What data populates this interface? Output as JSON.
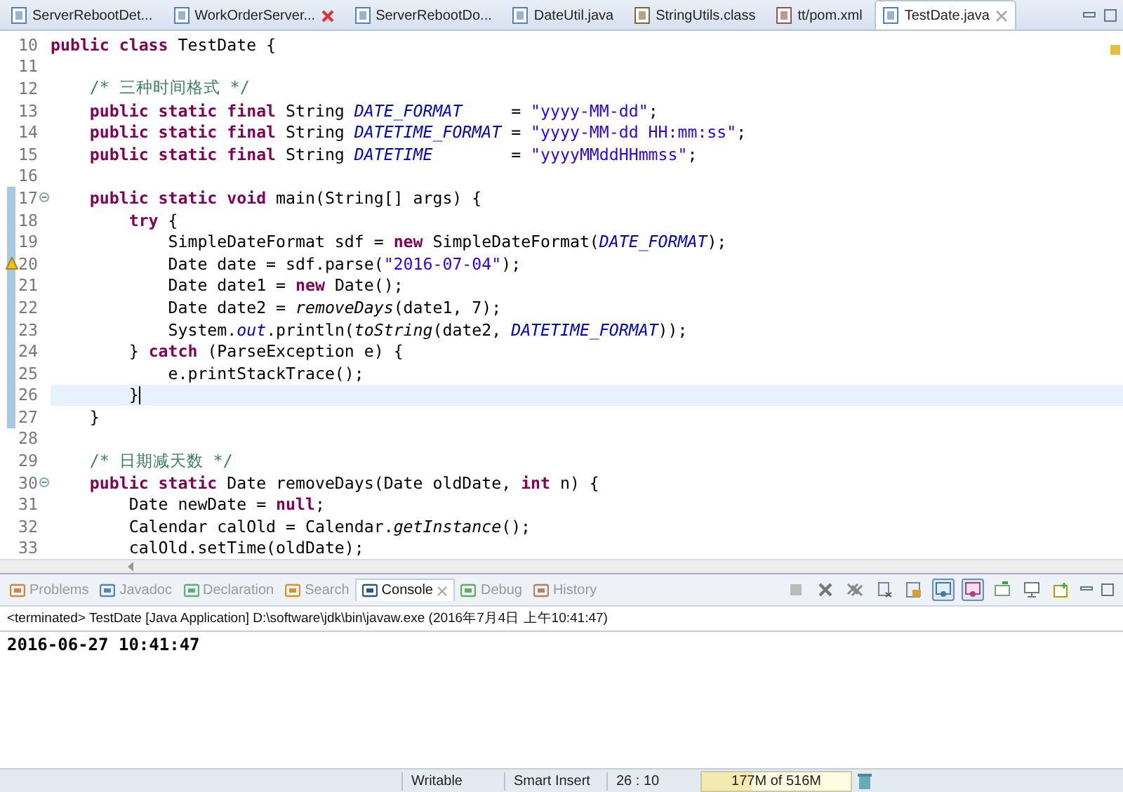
{
  "editor_tabs": [
    {
      "label": "ServerRebootDet...",
      "kind": "java",
      "selected": false,
      "hovered": false
    },
    {
      "label": "WorkOrderServer...",
      "kind": "java",
      "selected": false,
      "hovered": true
    },
    {
      "label": "ServerRebootDo...",
      "kind": "java",
      "selected": false,
      "hovered": false
    },
    {
      "label": "DateUtil.java",
      "kind": "java",
      "selected": false,
      "hovered": false
    },
    {
      "label": "StringUtils.class",
      "kind": "class",
      "selected": false,
      "hovered": false
    },
    {
      "label": "tt/pom.xml",
      "kind": "xml",
      "selected": false,
      "hovered": false
    },
    {
      "label": "TestDate.java",
      "kind": "java",
      "selected": true,
      "hovered": false
    }
  ],
  "editor": {
    "lines": [
      {
        "number": "10",
        "in_range": false,
        "fold": false,
        "warning": false,
        "current": false,
        "segments": [
          {
            "kind": "keyword",
            "text": "public class"
          },
          {
            "kind": "plain",
            "text": " TestDate {"
          }
        ]
      },
      {
        "number": "11",
        "in_range": false,
        "fold": false,
        "warning": false,
        "current": false
      },
      {
        "number": "12",
        "in_range": false,
        "fold": false,
        "warning": false,
        "current": false,
        "segments": [
          {
            "kind": "comment",
            "text": "    /* 三种时间格式 */"
          }
        ]
      },
      {
        "number": "13",
        "in_range": false,
        "fold": false,
        "warning": false,
        "current": false,
        "segments": [
          {
            "kind": "keyword",
            "text": "    public static final"
          },
          {
            "kind": "plain",
            "text": " String "
          },
          {
            "kind": "constant",
            "text": "DATE_FORMAT"
          },
          {
            "kind": "plain",
            "text": "     = "
          },
          {
            "kind": "string",
            "text": "\"yyyy-MM-dd\""
          },
          {
            "kind": "plain",
            "text": ";"
          }
        ]
      },
      {
        "number": "14",
        "in_range": false,
        "fold": false,
        "warning": false,
        "current": false,
        "segments": [
          {
            "kind": "keyword",
            "text": "    public static final"
          },
          {
            "kind": "plain",
            "text": " String "
          },
          {
            "kind": "constant",
            "text": "DATETIME_FORMAT"
          },
          {
            "kind": "plain",
            "text": " = "
          },
          {
            "kind": "string",
            "text": "\"yyyy-MM-dd HH:mm:ss\""
          },
          {
            "kind": "plain",
            "text": ";"
          }
        ]
      },
      {
        "number": "15",
        "in_range": false,
        "fold": false,
        "warning": false,
        "current": false,
        "segments": [
          {
            "kind": "keyword",
            "text": "    public static final"
          },
          {
            "kind": "plain",
            "text": " String "
          },
          {
            "kind": "constant",
            "text": "DATETIME"
          },
          {
            "kind": "plain",
            "text": "        = "
          },
          {
            "kind": "string",
            "text": "\"yyyyMMddHHmmss\""
          },
          {
            "kind": "plain",
            "text": ";"
          }
        ]
      },
      {
        "number": "16",
        "in_range": false,
        "fold": false,
        "warning": false,
        "current": false
      },
      {
        "number": "17",
        "in_range": true,
        "fold": true,
        "warning": false,
        "current": false,
        "segments": [
          {
            "kind": "keyword",
            "text": "    public static void"
          },
          {
            "kind": "plain",
            "text": " main(String[] args) {"
          }
        ]
      },
      {
        "number": "18",
        "in_range": true,
        "fold": false,
        "warning": false,
        "current": false,
        "segments": [
          {
            "kind": "keyword",
            "text": "        try"
          },
          {
            "kind": "plain",
            "text": " {"
          }
        ]
      },
      {
        "number": "19",
        "in_range": true,
        "fold": false,
        "warning": false,
        "current": false,
        "segments": [
          {
            "kind": "plain",
            "text": "            SimpleDateFormat sdf = "
          },
          {
            "kind": "keyword",
            "text": "new"
          },
          {
            "kind": "plain",
            "text": " SimpleDateFormat("
          },
          {
            "kind": "constant",
            "text": "DATE_FORMAT"
          },
          {
            "kind": "plain",
            "text": ");"
          }
        ]
      },
      {
        "number": "20",
        "in_range": true,
        "fold": false,
        "warning": true,
        "current": false,
        "segments": [
          {
            "kind": "plain",
            "text": "            Date date = sdf.parse("
          },
          {
            "kind": "string",
            "text": "\"2016-07-04\""
          },
          {
            "kind": "plain",
            "text": ");"
          }
        ]
      },
      {
        "number": "21",
        "in_range": true,
        "fold": false,
        "warning": false,
        "current": false,
        "segments": [
          {
            "kind": "plain",
            "text": "            Date date1 = "
          },
          {
            "kind": "keyword",
            "text": "new"
          },
          {
            "kind": "plain",
            "text": " Date();"
          }
        ]
      },
      {
        "number": "22",
        "in_range": true,
        "fold": false,
        "warning": false,
        "current": false,
        "segments": [
          {
            "kind": "plain",
            "text": "            Date date2 = "
          },
          {
            "kind": "method",
            "text": "removeDays"
          },
          {
            "kind": "plain",
            "text": "(date1, 7);"
          }
        ]
      },
      {
        "number": "23",
        "in_range": true,
        "fold": false,
        "warning": false,
        "current": false,
        "segments": [
          {
            "kind": "plain",
            "text": "            System."
          },
          {
            "kind": "constant",
            "text": "out"
          },
          {
            "kind": "plain",
            "text": ".println("
          },
          {
            "kind": "method",
            "text": "toString"
          },
          {
            "kind": "plain",
            "text": "(date2, "
          },
          {
            "kind": "constant",
            "text": "DATETIME_FORMAT"
          },
          {
            "kind": "plain",
            "text": "));"
          }
        ]
      },
      {
        "number": "24",
        "in_range": true,
        "fold": false,
        "warning": false,
        "current": false,
        "segments": [
          {
            "kind": "plain",
            "text": "        } "
          },
          {
            "kind": "keyword",
            "text": "catch"
          },
          {
            "kind": "plain",
            "text": " (ParseException e) {"
          }
        ]
      },
      {
        "number": "25",
        "in_range": true,
        "fold": false,
        "warning": false,
        "current": false,
        "segments": [
          {
            "kind": "plain",
            "text": "            e.printStackTrace();"
          }
        ]
      },
      {
        "number": "26",
        "in_range": true,
        "fold": false,
        "warning": false,
        "current": true,
        "segments": [
          {
            "kind": "plain",
            "text": "        }"
          }
        ]
      },
      {
        "number": "27",
        "in_range": true,
        "fold": false,
        "warning": false,
        "current": false,
        "segments": [
          {
            "kind": "plain",
            "text": "    }"
          }
        ]
      },
      {
        "number": "28",
        "in_range": false,
        "fold": false,
        "warning": false,
        "current": false
      },
      {
        "number": "29",
        "in_range": false,
        "fold": false,
        "warning": false,
        "current": false,
        "segments": [
          {
            "kind": "comment",
            "text": "    /* 日期减天数 */"
          }
        ]
      },
      {
        "number": "30",
        "in_range": false,
        "fold": true,
        "warning": false,
        "current": false,
        "segments": [
          {
            "kind": "keyword",
            "text": "    public static"
          },
          {
            "kind": "plain",
            "text": " Date removeDays(Date oldDate, "
          },
          {
            "kind": "keyword",
            "text": "int"
          },
          {
            "kind": "plain",
            "text": " n) {"
          }
        ]
      },
      {
        "number": "31",
        "in_range": false,
        "fold": false,
        "warning": false,
        "current": false,
        "segments": [
          {
            "kind": "plain",
            "text": "        Date newDate = "
          },
          {
            "kind": "keyword",
            "text": "null"
          },
          {
            "kind": "plain",
            "text": ";"
          }
        ]
      },
      {
        "number": "32",
        "in_range": false,
        "fold": false,
        "warning": false,
        "current": false,
        "segments": [
          {
            "kind": "plain",
            "text": "        Calendar calOld = Calendar."
          },
          {
            "kind": "method",
            "text": "getInstance"
          },
          {
            "kind": "plain",
            "text": "();"
          }
        ]
      },
      {
        "number": "33",
        "in_range": false,
        "fold": false,
        "warning": false,
        "current": false,
        "segments": [
          {
            "kind": "plain",
            "text": "        calOld.setTime(oldDate);"
          }
        ]
      }
    ]
  },
  "console": {
    "tabs": [
      {
        "label": "Problems",
        "kind": "problems",
        "selected": false
      },
      {
        "label": "Javadoc",
        "kind": "javadoc",
        "selected": false
      },
      {
        "label": "Declaration",
        "kind": "declaration",
        "selected": false
      },
      {
        "label": "Search",
        "kind": "search",
        "selected": false
      },
      {
        "label": "Console",
        "kind": "console",
        "selected": true
      },
      {
        "label": "Debug",
        "kind": "debug",
        "selected": false
      },
      {
        "label": "History",
        "kind": "history",
        "selected": false
      }
    ],
    "toolbar": [
      {
        "kind": "stop",
        "pressed": false
      },
      {
        "kind": "remove",
        "pressed": false
      },
      {
        "kind": "remove_all",
        "pressed": false
      },
      {
        "kind": "clear",
        "pressed": false
      },
      {
        "kind": "lock",
        "pressed": false
      },
      {
        "kind": "show_out",
        "pressed": true
      },
      {
        "kind": "show_err",
        "pressed": true
      },
      {
        "kind": "pin",
        "pressed": false
      },
      {
        "kind": "display",
        "pressed": false
      },
      {
        "kind": "open",
        "pressed": false
      }
    ],
    "process": "<terminated> TestDate [Java Application] D:\\software\\jdk\\bin\\javaw.exe (2016年7月4日 上午10:41:47)",
    "output": "2016-06-27 10:41:47"
  },
  "status_bar": {
    "mode": "Writable",
    "insert": "Smart Insert",
    "position": "26 : 10",
    "heap": {
      "text": "177M of 516M",
      "level": 0.34
    }
  }
}
